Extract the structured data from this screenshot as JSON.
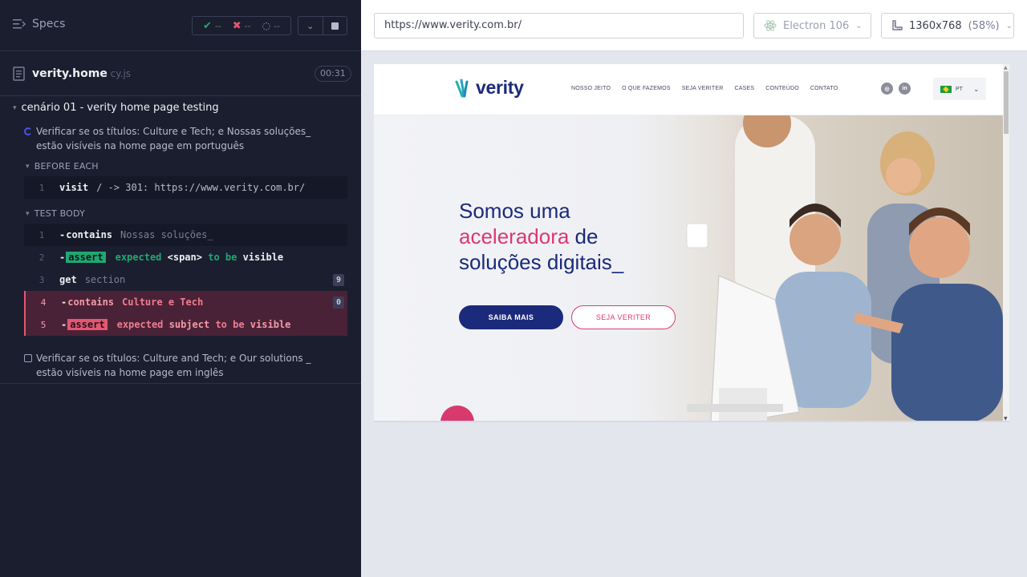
{
  "reporter": {
    "specs_label": "Specs",
    "stats": {
      "passed": "--",
      "failed": "--",
      "pending": "--"
    },
    "file": {
      "name": "verity.home",
      "ext": " cy.js",
      "duration": "00:31"
    },
    "suite": {
      "title": "cenário 01 - verity home page testing"
    },
    "tests": [
      {
        "title": "Verificar se os títulos: Culture e Tech; e Nossas soluções_ estão visíveis na home page em português",
        "state": "running",
        "before_each_label": "BEFORE EACH",
        "test_body_label": "TEST BODY",
        "before_each": [
          {
            "num": "1",
            "name": "visit",
            "message": "/ -> 301: https://www.verity.com.br/"
          }
        ],
        "commands": [
          {
            "num": "1",
            "name": "contains",
            "message": "Nossas soluções_"
          },
          {
            "num": "2",
            "badge": "assert",
            "m1": "expected",
            "m2": "<span>",
            "m3": "to be",
            "m4": "visible"
          },
          {
            "num": "3",
            "name": "get",
            "message": "section",
            "count": "9"
          },
          {
            "num": "4",
            "name": "contains",
            "message": "Culture e Tech",
            "count": "0"
          },
          {
            "num": "5",
            "badge": "assert",
            "m1": "expected",
            "m2": "subject",
            "m3": "to be",
            "m4": "visible"
          }
        ]
      },
      {
        "title": "Verificar se os títulos: Culture and Tech; e Our solutions _ estão visíveis na home page em inglês",
        "state": "pending"
      }
    ]
  },
  "runner": {
    "url": "https://www.verity.com.br/",
    "browser": "Electron 106",
    "viewport": "1360x768",
    "scale": "(58%)"
  },
  "site": {
    "logo_text": "verity",
    "nav": [
      "NOSSO JEITO",
      "O QUE FAZEMOS",
      "SEJA VERITER",
      "CASES",
      "CONTEÚDO",
      "CONTATO"
    ],
    "lang": "PT",
    "hero": {
      "line1": "Somos uma",
      "line2_pink": "aceleradora",
      "line2_rest": " de",
      "line3": "soluções digitais_"
    },
    "btn_primary": "SAIBA MAIS",
    "btn_secondary": "SEJA VERITER"
  },
  "colors": {
    "brand_navy": "#1b2a7a",
    "brand_pink": "#d93a6e",
    "pass_green": "#1fa971",
    "fail_red": "#e45770",
    "reporter_bg": "#1b1e2e"
  }
}
